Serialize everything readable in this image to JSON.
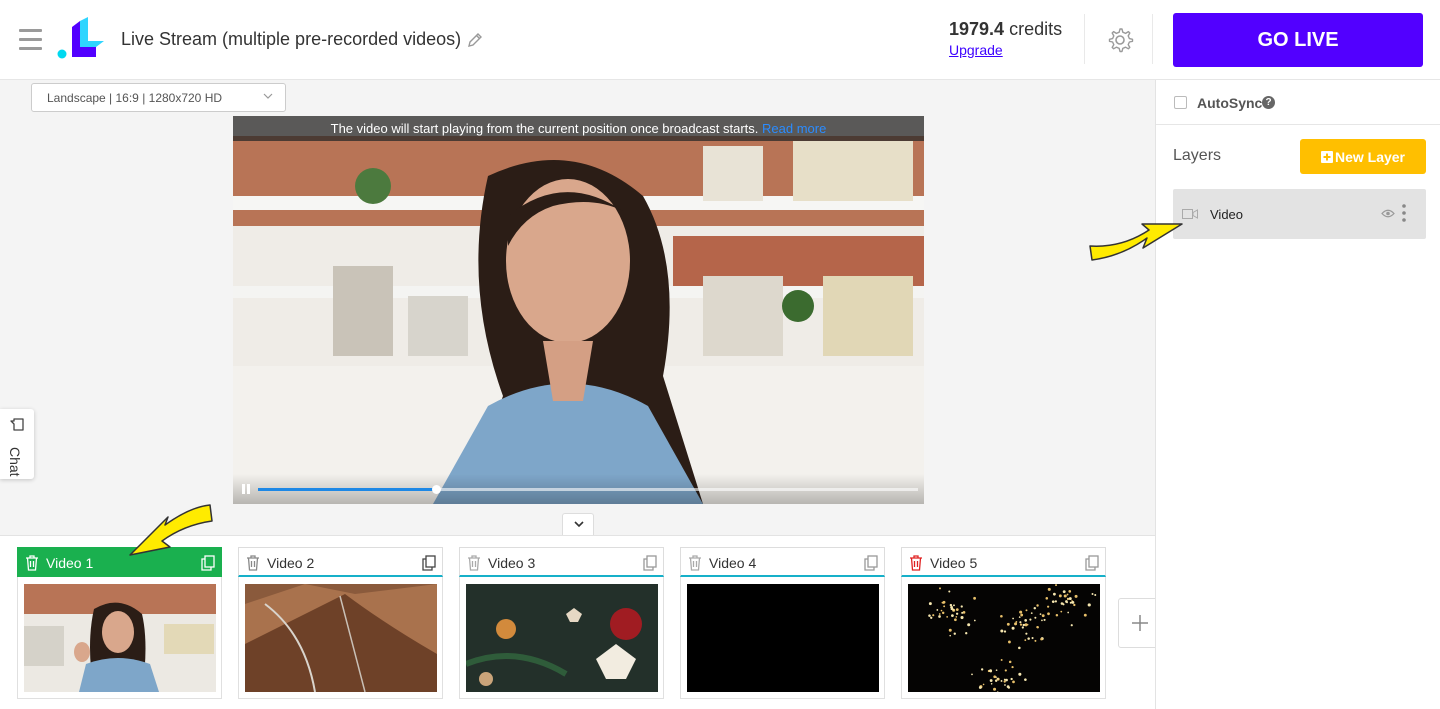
{
  "header": {
    "menu_icon": "hamburger-icon",
    "title": "Live Stream (multiple pre-recorded videos)",
    "edit_icon": "pencil-icon",
    "credits_value": "1979.4",
    "credits_unit": "credits",
    "upgrade_label": "Upgrade",
    "settings_icon": "gear-icon",
    "go_live_label": "GO LIVE",
    "go_live_color": "#5200ff"
  },
  "canvas": {
    "resolution": "Landscape | 16:9 | 1280x720 HD",
    "notice_text": "The video will start playing from the current position once broadcast starts.",
    "notice_link": "Read more",
    "progress": 0.27
  },
  "chat": {
    "label": "Chat"
  },
  "videos": [
    {
      "name": "Video 1",
      "active": true
    },
    {
      "name": "Video 2",
      "active": false
    },
    {
      "name": "Video 3",
      "active": false
    },
    {
      "name": "Video 4",
      "active": false
    },
    {
      "name": "Video 5",
      "active": false
    }
  ],
  "sidebar": {
    "autosync_label": "AutoSync",
    "autosync_checked": false,
    "layers_title": "Layers",
    "new_layer_label": "New Layer",
    "new_layer_color": "#ffbf00",
    "layers": [
      {
        "name": "Video",
        "icon": "video-camera-icon"
      }
    ]
  }
}
